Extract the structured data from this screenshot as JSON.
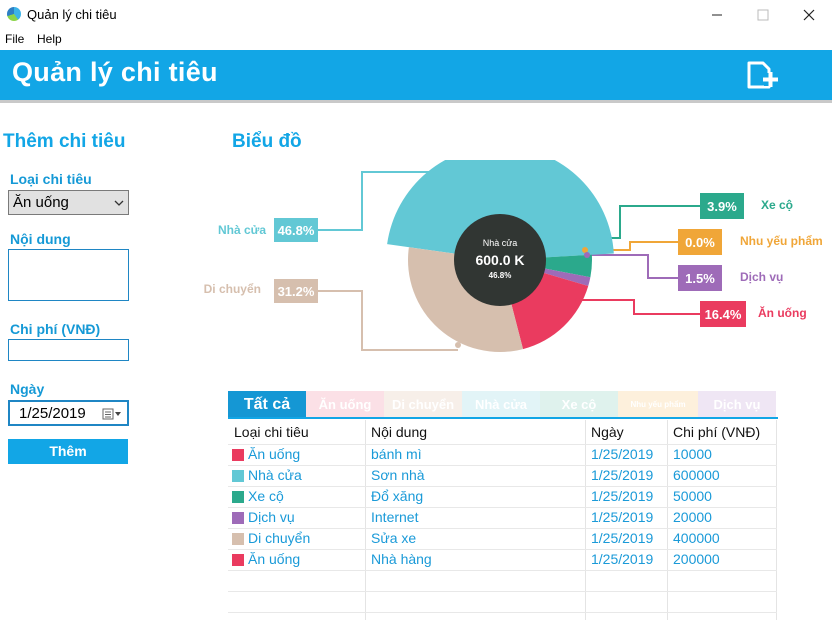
{
  "window": {
    "title": "Quản lý chi tiêu"
  },
  "menu": [
    "File",
    "Help"
  ],
  "header": {
    "title": "Quản lý chi tiêu"
  },
  "form": {
    "section_title": "Thêm chi tiêu",
    "category_label": "Loại chi tiêu",
    "category_value": "Ăn uống",
    "content_label": "Nội dung",
    "content_value": "",
    "cost_label": "Chi phí (VNĐ)",
    "cost_value": "",
    "date_label": "Ngày",
    "date_value": "1/25/2019",
    "submit_label": "Thêm"
  },
  "chart_section_title": "Biểu đồ",
  "chart_data": {
    "type": "pie",
    "slices": [
      {
        "label": "Nhà cửa",
        "value": 600000,
        "percent": "46.8%",
        "color": "#62c8d5"
      },
      {
        "label": "Xe cộ",
        "value": 50000,
        "percent": "3.9%",
        "color": "#2ba98c"
      },
      {
        "label": "Nhu yếu phẩm",
        "value": 0,
        "percent": "0.0%",
        "color": "#f0a638"
      },
      {
        "label": "Dịch vụ",
        "value": 20000,
        "percent": "1.5%",
        "color": "#9e6bb8"
      },
      {
        "label": "Ăn uống",
        "value": 210000,
        "percent": "16.4%",
        "color": "#ea3b5f"
      },
      {
        "label": "Di chuyển",
        "value": 400000,
        "percent": "31.2%",
        "color": "#d6bfae"
      }
    ],
    "center": {
      "label": "Nhà cửa",
      "value": "600.0 K",
      "percent": "46.8%"
    },
    "highlighted": "Nhà cửa"
  },
  "tabs": [
    {
      "label": "Tất cả",
      "active": true,
      "color": "#1597d4"
    },
    {
      "label": "Ăn uống",
      "active": false,
      "color": "#fbe0e6"
    },
    {
      "label": "Di chuyển",
      "active": false,
      "color": "#f7efe9"
    },
    {
      "label": "Nhà cửa",
      "active": false,
      "color": "#e2f4f7"
    },
    {
      "label": "Xe cộ",
      "active": false,
      "color": "#dff2ed"
    },
    {
      "label": "Nhu yếu phẩm",
      "active": false,
      "color": "#fdf0dc"
    },
    {
      "label": "Dịch vụ",
      "active": false,
      "color": "#efe6f4"
    }
  ],
  "table": {
    "headers": [
      "Loại chi tiêu",
      "Nội dung",
      "Ngày",
      "Chi phí (VNĐ)"
    ],
    "rows": [
      {
        "category": "Ăn uống",
        "color": "#ea3b5f",
        "content": "bánh mì",
        "date": "1/25/2019",
        "cost": "10000"
      },
      {
        "category": "Nhà cửa",
        "color": "#62c8d5",
        "content": "Sơn nhà",
        "date": "1/25/2019",
        "cost": "600000"
      },
      {
        "category": "Xe cộ",
        "color": "#2ba98c",
        "content": "Đổ xăng",
        "date": "1/25/2019",
        "cost": "50000"
      },
      {
        "category": "Dịch vụ",
        "color": "#9e6bb8",
        "content": "Internet",
        "date": "1/25/2019",
        "cost": "20000"
      },
      {
        "category": "Di chuyển",
        "color": "#d6bfae",
        "content": "Sửa xe",
        "date": "1/25/2019",
        "cost": "400000"
      },
      {
        "category": "Ăn uống",
        "color": "#ea3b5f",
        "content": "Nhà hàng",
        "date": "1/25/2019",
        "cost": "200000"
      }
    ]
  }
}
